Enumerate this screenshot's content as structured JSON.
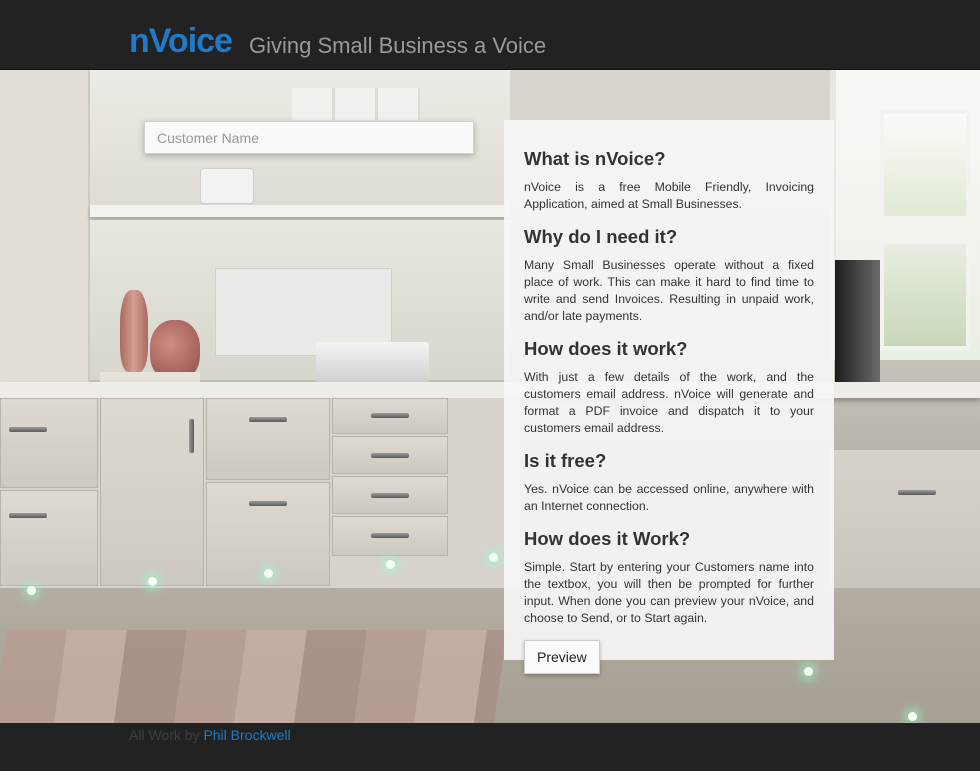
{
  "header": {
    "brand": "nVoice",
    "tagline": "Giving Small Business a Voice"
  },
  "form": {
    "customer_placeholder": "Customer Name",
    "customer_value": ""
  },
  "info": {
    "sections": [
      {
        "heading": "What is nVoice?",
        "body": "nVoice is a free Mobile Friendly, Invoicing Application, aimed at Small Businesses."
      },
      {
        "heading": "Why do I need it?",
        "body": "Many Small Businesses operate without a fixed place of work. This can make it hard to find time to write and send Invoices. Resulting in unpaid work, and/or late payments."
      },
      {
        "heading": "How does it work?",
        "body": "With just a few details of the work, and the customers email address. nVoice will generate and format a PDF invoice and dispatch it to your customers email address."
      },
      {
        "heading": "Is it free?",
        "body": "Yes. nVoice can be accessed online, anywhere with an Internet connection."
      },
      {
        "heading": "How does it Work?",
        "body": "Simple. Start by entering your Customers name into the textbox, you will then be prompted for further input. When done you can preview your nVoice, and choose to Send, or to Start again."
      }
    ],
    "preview_label": "Preview"
  },
  "footer": {
    "prefix": "All Work by ",
    "author": "Phil Brockwell"
  },
  "colors": {
    "brand": "#1f7ac9",
    "header_bg": "#222222",
    "panel_bg": "#f6f6f6"
  },
  "background": {
    "icon": "kitchen-photo"
  }
}
